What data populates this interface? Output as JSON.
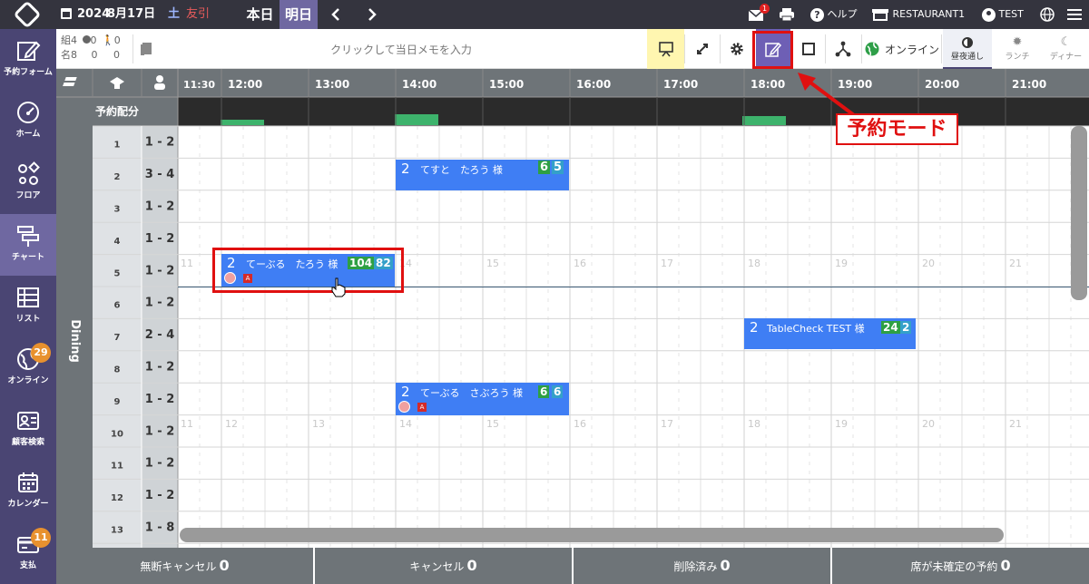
{
  "topbar": {
    "year": "2024",
    "date": "8月17日",
    "weekday": "土",
    "tomobiki": "友引",
    "today_label": "本日",
    "tomorrow_label": "明日",
    "mail_badge": "1",
    "help_label": "ヘルプ",
    "restaurant_label": "RESTAURANT1",
    "user_label": "TEST"
  },
  "counts": {
    "groups_label": "組",
    "groups_value": "4",
    "people_label": "名",
    "people_value": "8",
    "online_groups": "0",
    "online_people": "0",
    "walkin_groups": "0",
    "walkin_people": "0"
  },
  "toolbar": {
    "memo_placeholder": "クリックして当日メモを入力",
    "online_label": "オンライン",
    "mode_allday": "昼夜通し",
    "mode_lunch": "ランチ",
    "mode_dinner": "ディナー"
  },
  "nav": [
    {
      "label": "予約フォーム",
      "icon": "edit-icon"
    },
    {
      "label": "ホーム",
      "icon": "gauge-icon"
    },
    {
      "label": "フロア",
      "icon": "floor-shapes-icon"
    },
    {
      "label": "チャート",
      "icon": "chart-icon",
      "active": true
    },
    {
      "label": "リスト",
      "icon": "list-table-icon"
    },
    {
      "label": "オンライン",
      "icon": "globe-icon",
      "badge": "29"
    },
    {
      "label": "顧客検索",
      "icon": "id-card-icon"
    },
    {
      "label": "カレンダー",
      "icon": "calendar-icon"
    },
    {
      "label": "支払",
      "icon": "card-icon",
      "badge": "11"
    }
  ],
  "chart": {
    "times_header": [
      "11:30",
      "12:00",
      "13:00",
      "14:00",
      "15:00",
      "16:00",
      "17:00",
      "18:00",
      "19:00",
      "20:00",
      "21:00"
    ],
    "quota_label": "予約配分",
    "section_label": "Dining",
    "faint_hours": [
      "11",
      "12",
      "13",
      "14",
      "15",
      "16",
      "17",
      "18",
      "19",
      "20",
      "21"
    ],
    "tables": [
      {
        "name": "1",
        "cap": "1 - 2"
      },
      {
        "name": "2",
        "cap": "3 - 4"
      },
      {
        "name": "3",
        "cap": "1 - 2"
      },
      {
        "name": "4",
        "cap": "1 - 2"
      },
      {
        "name": "5",
        "cap": "1 - 2"
      },
      {
        "name": "6",
        "cap": "1 - 2"
      },
      {
        "name": "7",
        "cap": "2 - 4"
      },
      {
        "name": "8",
        "cap": "1 - 2"
      },
      {
        "name": "9",
        "cap": "1 - 2"
      },
      {
        "name": "10",
        "cap": "1 - 2"
      },
      {
        "name": "11",
        "cap": "1 - 2"
      },
      {
        "name": "12",
        "cap": "1 - 2"
      },
      {
        "name": "13",
        "cap": "1 - 8"
      }
    ],
    "reservations": [
      {
        "people": "2",
        "name": "てすと　たろう 様",
        "tags": [
          "6",
          "5"
        ]
      },
      {
        "people": "2",
        "name": "てーぶる　たろう 様",
        "tags": [
          "104",
          "82"
        ]
      },
      {
        "people": "2",
        "name": "TableCheck TEST 様",
        "tags": [
          "24",
          "2"
        ]
      },
      {
        "people": "2",
        "name": "てーぶる　さぶろう 様",
        "tags": [
          "6",
          "6"
        ]
      }
    ]
  },
  "callout_label": "予約モード",
  "bottom": [
    {
      "label": "無断キャンセル",
      "value": "0"
    },
    {
      "label": "キャンセル",
      "value": "0"
    },
    {
      "label": "削除済み",
      "value": "0"
    },
    {
      "label": "席が未確定の予約",
      "value": "0"
    }
  ],
  "colors": {
    "topbar": "#34343e",
    "nav": "#4a4573",
    "nav_active": "#6f68a1",
    "reservation": "#3f7ef4",
    "tag_green": "#2ea043",
    "highlight_red": "#e01010",
    "mode_button": "#6e5fb5"
  }
}
